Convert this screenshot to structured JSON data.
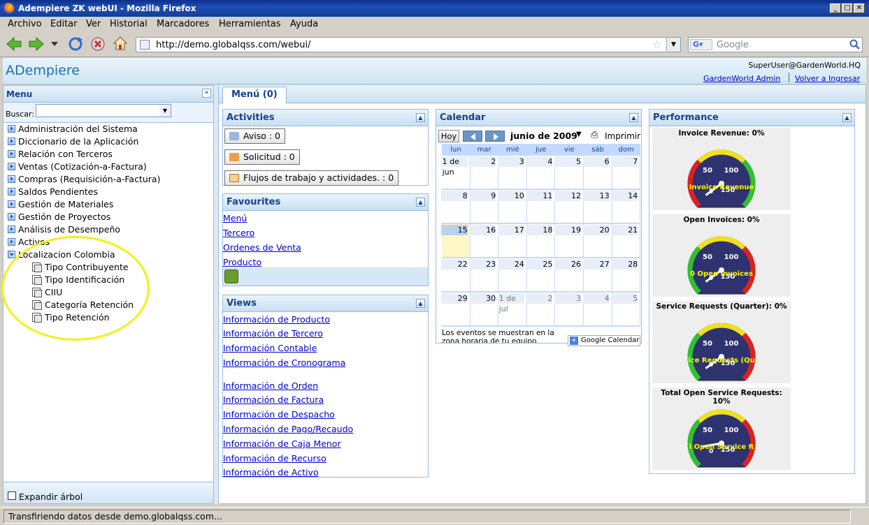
{
  "window": {
    "title": "Adempiere ZK webUI - Mozilla Firefox"
  },
  "menubar": {
    "items": [
      "Archivo",
      "Editar",
      "Ver",
      "Historial",
      "Marcadores",
      "Herramientas",
      "Ayuda"
    ]
  },
  "navbar": {
    "url": "http://demo.globalqss.com/webui/",
    "search_placeholder": "Google"
  },
  "app_header": {
    "logo": "ADempiere",
    "user": "SuperUser@GardenWorld.HQ",
    "role_link": "GardenWorld Admin",
    "relogin_link": "Volver a Ingresar"
  },
  "west": {
    "title": "Menu",
    "search_label": "Buscar:",
    "expand_label": "Expandir árbol",
    "tree": [
      "Administración del Sistema",
      "Diccionario de la Aplicación",
      "Relación con Terceros",
      "Ventas (Cotización-a-Factura)",
      "Compras (Requisición-a-Factura)",
      "Saldos Pendientes",
      "Gestión de Materiales",
      "Gestión de Proyectos",
      "Análisis de Desempeño",
      "Activos",
      "Localizacion Colombia"
    ],
    "subtree": [
      "Tipo Contribuyente",
      "Tipo Identificación",
      "CIIU",
      "Categoría Retención",
      "Tipo Retención"
    ]
  },
  "tab": {
    "label": "Menú (0)"
  },
  "activities": {
    "title": "Activities",
    "aviso": "Aviso : 0",
    "solicitud": "Solicitud : 0",
    "flujos": "Flujos de trabajo y actividades. : 0"
  },
  "favourites": {
    "title": "Favourites",
    "items": [
      "Menú",
      "Tercero",
      "Ordenes de Venta",
      "Producto"
    ]
  },
  "views": {
    "title": "Views",
    "group1": [
      "Información de Producto",
      "Información de Tercero",
      "Información Contable",
      "Información de Cronograma"
    ],
    "group2": [
      "Información de Orden",
      "Información de Factura",
      "Información de Despacho",
      "Información de Pago/Recaudo",
      "Información de Caja Menor",
      "Información de Recurso",
      "Información de Activo"
    ]
  },
  "calendar": {
    "title": "Calendar",
    "today": "Hoy",
    "month": "junio de 2009",
    "print": "Imprimir",
    "dow": [
      "lun",
      "mar",
      "mié",
      "jue",
      "vie",
      "sáb",
      "dom"
    ],
    "weeks": [
      [
        "1 de jun",
        "2",
        "3",
        "4",
        "5",
        "6",
        "7"
      ],
      [
        "8",
        "9",
        "10",
        "11",
        "12",
        "13",
        "14"
      ],
      [
        "15",
        "16",
        "17",
        "18",
        "19",
        "20",
        "21"
      ],
      [
        "22",
        "23",
        "24",
        "25",
        "26",
        "27",
        "28"
      ],
      [
        "29",
        "30",
        "1 de jul",
        "2",
        "3",
        "4",
        "5"
      ]
    ],
    "footer": "Los eventos se muestran en la zona horaria de tu equipo",
    "badge": "Google Calendar"
  },
  "performance": {
    "title": "Performance",
    "gauges": [
      {
        "title": "Invoice Revenue: 0%",
        "label": "Invoice Revenue",
        "pct": 0
      },
      {
        "title": "Open Invoices: 0%",
        "label": "0 Open Invoices",
        "pct": 0
      },
      {
        "title": "Service Requests (Quarter): 0%",
        "label": "ice Requests (Qu",
        "pct": 0
      },
      {
        "title": "Total Open Service Requests: 10%",
        "label": "l Open Service R",
        "pct": 10
      }
    ],
    "ticks": {
      "a": "0",
      "b": "50",
      "c": "100",
      "d": "150"
    }
  },
  "status": {
    "text": "Transfiriendo datos desde demo.globalqss.com..."
  }
}
